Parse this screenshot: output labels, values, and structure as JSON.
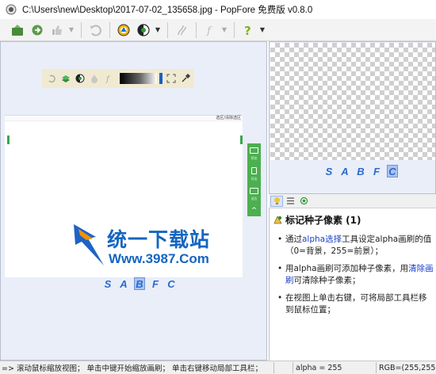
{
  "window": {
    "title": "C:\\Users\\new\\Desktop\\2017-07-02_135658.jpg - PopFore 免费版 v0.8.0"
  },
  "toolbar": {
    "buttons": [
      "open-icon",
      "save-icon",
      "thumb-icon",
      "undo-icon",
      "tri-color-icon",
      "half-contrast-icon",
      "brush-icon",
      "fx-icon",
      "help-icon"
    ]
  },
  "canvas": {
    "image_top_label": "选区/清除选区",
    "side_labels": [
      "预览",
      "导出",
      "适应"
    ],
    "logo_cn": "统一下载站",
    "logo_url": "Www.3987.Com"
  },
  "left_channels": {
    "letters": [
      "S",
      "A",
      "B",
      "F",
      "C"
    ],
    "selected": "B"
  },
  "right_channels": {
    "letters": [
      "S",
      "A",
      "B",
      "F",
      "C"
    ],
    "selected": "C"
  },
  "help": {
    "title": "标记种子像素 (1)",
    "items": [
      {
        "a": "通过",
        "b": "alpha选择",
        "c": "工具设定alpha画刷的值（0=背景，255=前景）；"
      },
      {
        "a": "用alpha画刷可添加种子像素，用",
        "b": "清除画刷",
        "c": "可清除种子像素；"
      },
      {
        "a": "在视图上单击右键，可将局部工具栏移到鼠标位置；",
        "b": "",
        "c": ""
      }
    ]
  },
  "status": {
    "message": "=> 滚动鼠标缩放视图； 单击中键开始缩放画刷； 单击右键移动局部工具栏；",
    "alpha": "alpha = 255",
    "rgb": "RGB=(255,255,255)"
  },
  "colors": {
    "accent": "#2a6acc",
    "green": "#4caf50",
    "canvas_bg": "#e9eef9"
  }
}
